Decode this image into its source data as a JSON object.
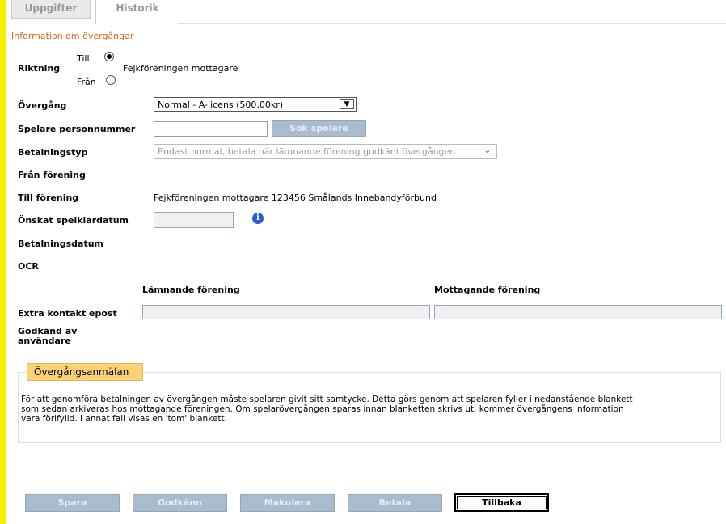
{
  "tabs": [
    {
      "label": "Uppgifter"
    },
    {
      "label": "Historik"
    }
  ],
  "section_title": "Information om övergångar",
  "riktning": {
    "label": "Riktning",
    "option_till": "Till",
    "option_fran": "Från",
    "selected": "Till",
    "club_name": "Fejkföreningen mottagare"
  },
  "overgang": {
    "label": "Övergång",
    "value": "Normal - A-licens (500,00kr)"
  },
  "personnummer": {
    "label": "Spelare personnummer",
    "value": "",
    "search_button": "Sök spelare"
  },
  "betalningstyp": {
    "label": "Betalningstyp",
    "value": "Endast normal, betala när lämnande förening godkänt övergången"
  },
  "fran_forening": {
    "label": "Från förening",
    "value": ""
  },
  "till_forening": {
    "label": "Till förening",
    "value": "Fejkföreningen mottagare 123456 Smålands Innebandyförbund"
  },
  "spelklardatum": {
    "label": "Önskat spelklardatum",
    "value": ""
  },
  "betalningsdatum": {
    "label": "Betalningsdatum",
    "value": ""
  },
  "ocr": {
    "label": "OCR",
    "value": ""
  },
  "columns": {
    "lamnande": "Lämnande förening",
    "mottagande": "Mottagande förening"
  },
  "extra_kontakt": {
    "label": "Extra kontakt epost",
    "lamnande_value": "",
    "mottagande_value": ""
  },
  "godkand_av": {
    "label_line1": "Godkänd av",
    "label_line2": "användare"
  },
  "overgangsanmalan": {
    "legend": "Övergångsanmälan",
    "text_line1": "För att genomföra betalningen av övergången måste spelaren givit sitt samtycke. Detta görs genom att spelaren fyller i nedanstående blankett",
    "text_line2": "som sedan arkiveras hos mottagande föreningen. Om spelarövergången sparas innan blanketten skrivs ut, kommer övergångens information",
    "text_line3": "vara förifylld. I annat fall visas en 'tom' blankett."
  },
  "buttons": {
    "spara": "Spara",
    "godkann": "Godkänn",
    "makulera": "Makulera",
    "betala": "Betala",
    "tillbaka": "Tillbaka"
  },
  "colors": {
    "accent_orange": "#e4641b",
    "side_bar_yellow": "#f4ee00",
    "legend_bg": "#fbd176",
    "disabled_button": "#a9bccf"
  }
}
